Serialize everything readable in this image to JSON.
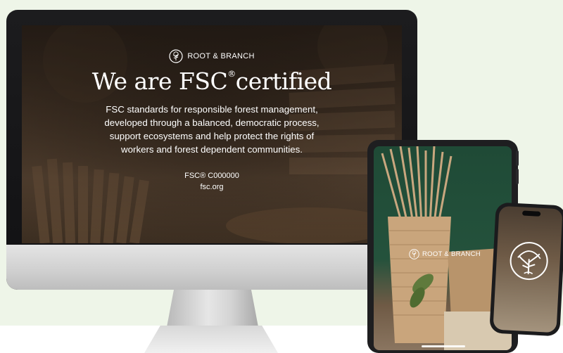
{
  "brand": {
    "name": "ROOT & BRANCH"
  },
  "hero": {
    "title": "We are FSC",
    "title_mark": "®",
    "title_end": "certified",
    "description": "FSC standards for responsible forest management, developed through a balanced, democratic process, support ecosystems and help protect the rights of workers and forest dependent communities.",
    "certificate_code": "FSC® C000000",
    "website": "fsc.org"
  },
  "colors": {
    "background": "#eef5e8",
    "tablet_backdrop": "#1f4a36",
    "text_on_image": "#ffffff"
  },
  "icons": [
    "tree-logo-icon"
  ]
}
